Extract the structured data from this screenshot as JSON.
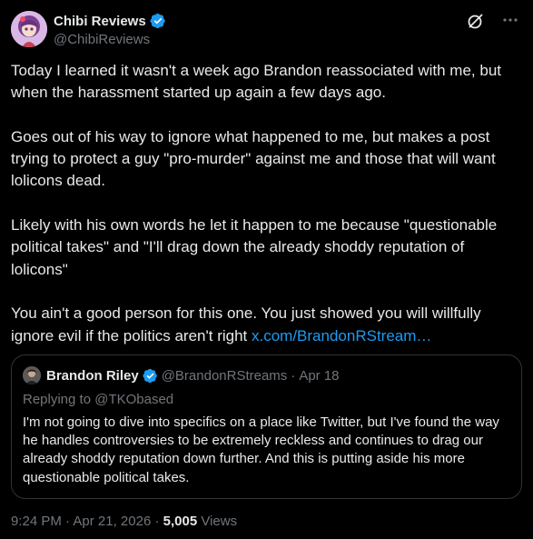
{
  "author": {
    "display_name": "Chibi Reviews",
    "handle": "@ChibiReviews",
    "verified": true
  },
  "header_actions": {
    "grok_icon": "grok-icon",
    "more_icon": "more-icon"
  },
  "tweet": {
    "paragraphs": [
      "Today I learned it wasn't a week ago Brandon reassociated with me, but when the harassment started up again a few days ago.",
      "Goes out of his way to ignore what happened to me, but makes a post trying to protect a guy \"pro-murder\" against me and those that will want lolicons dead.",
      "Likely with his own words he let it happen to me because \"questionable political takes\" and \"I'll drag down the already shoddy reputation of lolicons\"",
      "You ain't a good person for this one. You just showed you will willfully ignore evil if the politics aren't right "
    ],
    "link_text": "x.com/BrandonRStream…"
  },
  "quote": {
    "display_name": "Brandon Riley",
    "handle": "@BrandonRStreams",
    "separator": "·",
    "date": "Apr 18",
    "replying_to": "Replying to @TKObased",
    "text": "I'm not going to dive into specifics on a place like Twitter, but I've found the way he handles controversies to be extremely reckless and continues to drag our already shoddy reputation down further. And this is putting aside his more questionable political takes."
  },
  "meta": {
    "time": "9:24 PM",
    "separator": "·",
    "date": "Apr 21, 2026",
    "views_count": "5,005",
    "views_label": "Views"
  },
  "colors": {
    "background": "#000000",
    "text": "#e7e9ea",
    "secondary": "#71767b",
    "link": "#1d9bf0",
    "border": "#2f3336",
    "verified": "#1d9bf0"
  }
}
